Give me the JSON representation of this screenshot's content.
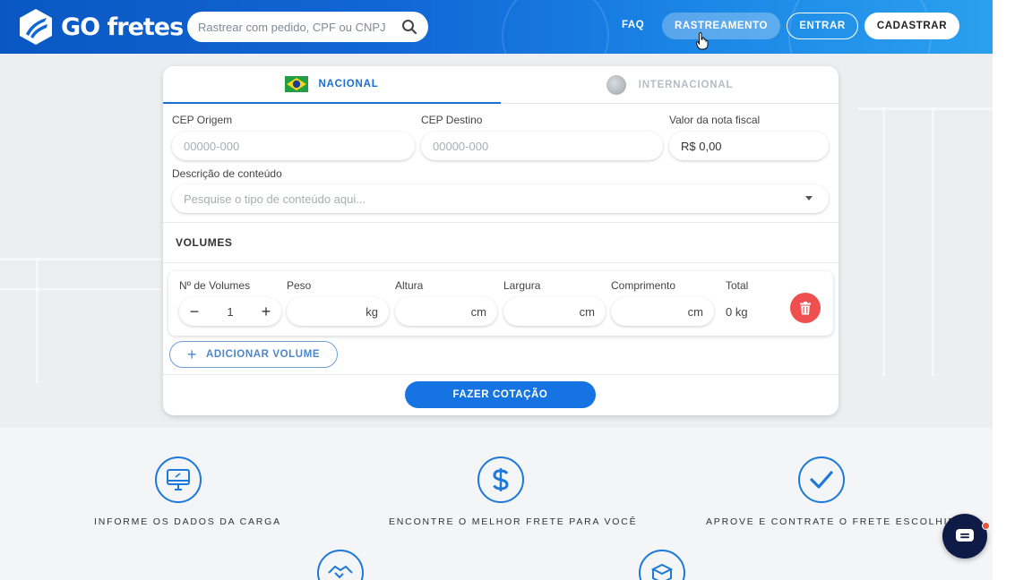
{
  "brand": {
    "logo_text": "GO fretes"
  },
  "search": {
    "placeholder": "Rastrear com pedido, CPF ou CNPJ"
  },
  "nav": {
    "faq": "FAQ",
    "tracking": "RASTREAMENTO",
    "login": "ENTRAR",
    "signup": "CADASTRAR"
  },
  "tabs": [
    {
      "label": "NACIONAL",
      "active": true
    },
    {
      "label": "INTERNACIONAL",
      "active": false
    }
  ],
  "form": {
    "cep_origin_label": "CEP Origem",
    "cep_origin_placeholder": "00000-000",
    "cep_dest_label": "CEP Destino",
    "cep_dest_placeholder": "00000-000",
    "invoice_label": "Valor da nota fiscal",
    "invoice_value": "R$ 0,00",
    "content_label": "Descrição de conteúdo",
    "content_placeholder": "Pesquise o tipo de conteúdo aqui..."
  },
  "volumes": {
    "title": "VOLUMES",
    "count_label": "Nº de Volumes",
    "count_value": "1",
    "minus": "−",
    "plus": "+",
    "weight_label": "Peso",
    "weight_unit": "kg",
    "height_label": "Altura",
    "height_unit": "cm",
    "width_label": "Largura",
    "width_unit": "cm",
    "length_label": "Comprimento",
    "length_unit": "cm",
    "total_label": "Total",
    "total_value": "0 kg"
  },
  "actions": {
    "add_volume_plus": "+",
    "add_volume": "ADICIONAR VOLUME",
    "quote": "FAZER COTAÇÃO"
  },
  "steps": [
    {
      "label": "INFORME OS DADOS DA CARGA",
      "icon": "monitor-icon"
    },
    {
      "label": "ENCONTRE O MELHOR FRETE PARA VOCÊ",
      "icon": "dollar-icon"
    },
    {
      "label": "APROVE E CONTRATE O FRETE ESCOLHIDO",
      "icon": "check-icon"
    }
  ],
  "colors": {
    "primary": "#1573e2",
    "delete": "#ef4f4f",
    "chat": "#0d1b46"
  }
}
